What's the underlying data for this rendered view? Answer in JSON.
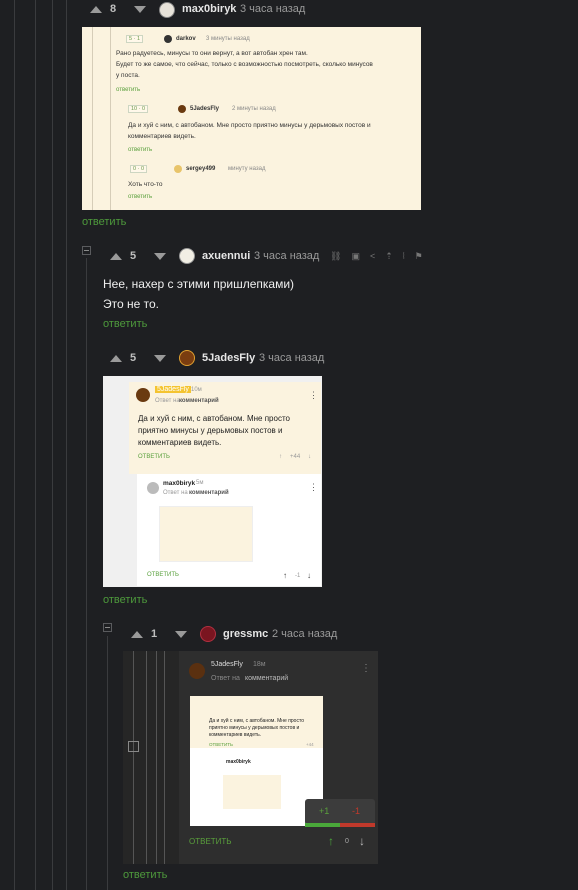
{
  "comments": [
    {
      "votes": "8",
      "username": "max0biryk",
      "time": "3 часа назад",
      "reply": "ответить",
      "embedded": {
        "c1_votes": "5 · 1",
        "c1_user": "darkov",
        "c1_time": "3 минуты назад",
        "c1_line1": "Рано радуетесь, минусы то они вернут, а вот автобан хрен там.",
        "c1_line2": "Будет то же самое, что сейчас, только с возможностью посмотреть, сколько минусов",
        "c1_line3": "у поста.",
        "c1_reply": "ответить",
        "c2_votes": "10 · 0",
        "c2_user": "5JadesFly",
        "c2_time": "2 минуты назад",
        "c2_line1": "Да и хуй с ним, с автобаном. Мне просто приятно минусы у дерьмовых постов и",
        "c2_line2": "комментариев видеть.",
        "c2_reply": "ответить",
        "c3_votes": "0 · 0",
        "c3_user": "sergey499",
        "c3_time": "минуту назад",
        "c3_line1": "Хоть что-то",
        "c3_reply": "ответить"
      }
    },
    {
      "votes": "5",
      "username": "axuennui",
      "time": "3 часа назад",
      "line1": "Нее, нахер с этими пришлепками)",
      "line2": "Это не то.",
      "reply": "ответить"
    },
    {
      "votes": "5",
      "username": "5JadesFly",
      "time": "3 часа назад",
      "reply": "ответить",
      "embedded": {
        "user": "5JadesFly",
        "time": "10м",
        "answer_to": "Ответ на",
        "answer_target": "комментарий",
        "body1": "Да и хуй с ним, с автобаном. Мне просто",
        "body2": "приятно минусы у дерьмовых постов и",
        "body3": "комментариев видеть.",
        "reply": "ОТВЕТИТЬ",
        "score": "+44",
        "inner_user": "max0biryk",
        "inner_time": "5м",
        "inner_reply": "ОТВЕТИТЬ",
        "inner_score": "-1"
      }
    },
    {
      "votes": "1",
      "username": "gressmc",
      "time": "2 часа назад",
      "reply": "ответить",
      "embedded": {
        "user": "5JadesFly",
        "time": "18м",
        "answer_to": "Ответ на",
        "answer_target": "комментарий",
        "reply": "ОТВЕТИТЬ",
        "score": "0",
        "plus": "+1",
        "minus": "-1",
        "mini_body1": "Да и хуй с ним, с автобаном. Мне просто",
        "mini_body2": "приятно минусы у дерьмовых постов и",
        "mini_body3": "комментариев видеть.",
        "mini_reply": "ОТВЕТИТЬ",
        "mini_score": "+44",
        "mini_inner_user": "max0biryk"
      }
    }
  ],
  "colors": {
    "background": "#1e1f22",
    "link": "#4e9a3c",
    "text": "#efefef"
  }
}
